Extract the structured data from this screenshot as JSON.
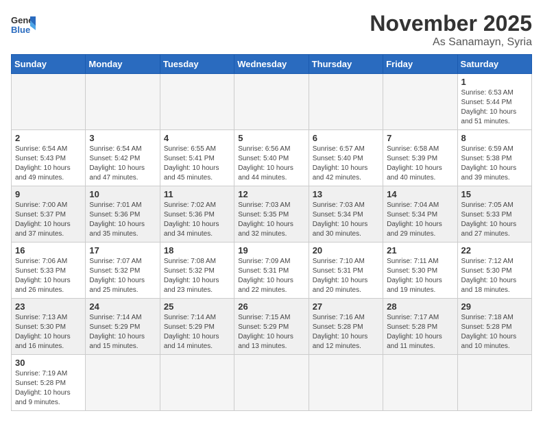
{
  "header": {
    "logo_general": "General",
    "logo_blue": "Blue",
    "month_title": "November 2025",
    "location": "As Sanamayn, Syria"
  },
  "weekdays": [
    "Sunday",
    "Monday",
    "Tuesday",
    "Wednesday",
    "Thursday",
    "Friday",
    "Saturday"
  ],
  "days": {
    "1": {
      "sunrise": "6:53 AM",
      "sunset": "5:44 PM",
      "daylight": "10 hours and 51 minutes."
    },
    "2": {
      "sunrise": "6:54 AM",
      "sunset": "5:43 PM",
      "daylight": "10 hours and 49 minutes."
    },
    "3": {
      "sunrise": "6:54 AM",
      "sunset": "5:42 PM",
      "daylight": "10 hours and 47 minutes."
    },
    "4": {
      "sunrise": "6:55 AM",
      "sunset": "5:41 PM",
      "daylight": "10 hours and 45 minutes."
    },
    "5": {
      "sunrise": "6:56 AM",
      "sunset": "5:40 PM",
      "daylight": "10 hours and 44 minutes."
    },
    "6": {
      "sunrise": "6:57 AM",
      "sunset": "5:40 PM",
      "daylight": "10 hours and 42 minutes."
    },
    "7": {
      "sunrise": "6:58 AM",
      "sunset": "5:39 PM",
      "daylight": "10 hours and 40 minutes."
    },
    "8": {
      "sunrise": "6:59 AM",
      "sunset": "5:38 PM",
      "daylight": "10 hours and 39 minutes."
    },
    "9": {
      "sunrise": "7:00 AM",
      "sunset": "5:37 PM",
      "daylight": "10 hours and 37 minutes."
    },
    "10": {
      "sunrise": "7:01 AM",
      "sunset": "5:36 PM",
      "daylight": "10 hours and 35 minutes."
    },
    "11": {
      "sunrise": "7:02 AM",
      "sunset": "5:36 PM",
      "daylight": "10 hours and 34 minutes."
    },
    "12": {
      "sunrise": "7:03 AM",
      "sunset": "5:35 PM",
      "daylight": "10 hours and 32 minutes."
    },
    "13": {
      "sunrise": "7:03 AM",
      "sunset": "5:34 PM",
      "daylight": "10 hours and 30 minutes."
    },
    "14": {
      "sunrise": "7:04 AM",
      "sunset": "5:34 PM",
      "daylight": "10 hours and 29 minutes."
    },
    "15": {
      "sunrise": "7:05 AM",
      "sunset": "5:33 PM",
      "daylight": "10 hours and 27 minutes."
    },
    "16": {
      "sunrise": "7:06 AM",
      "sunset": "5:33 PM",
      "daylight": "10 hours and 26 minutes."
    },
    "17": {
      "sunrise": "7:07 AM",
      "sunset": "5:32 PM",
      "daylight": "10 hours and 25 minutes."
    },
    "18": {
      "sunrise": "7:08 AM",
      "sunset": "5:32 PM",
      "daylight": "10 hours and 23 minutes."
    },
    "19": {
      "sunrise": "7:09 AM",
      "sunset": "5:31 PM",
      "daylight": "10 hours and 22 minutes."
    },
    "20": {
      "sunrise": "7:10 AM",
      "sunset": "5:31 PM",
      "daylight": "10 hours and 20 minutes."
    },
    "21": {
      "sunrise": "7:11 AM",
      "sunset": "5:30 PM",
      "daylight": "10 hours and 19 minutes."
    },
    "22": {
      "sunrise": "7:12 AM",
      "sunset": "5:30 PM",
      "daylight": "10 hours and 18 minutes."
    },
    "23": {
      "sunrise": "7:13 AM",
      "sunset": "5:30 PM",
      "daylight": "10 hours and 16 minutes."
    },
    "24": {
      "sunrise": "7:14 AM",
      "sunset": "5:29 PM",
      "daylight": "10 hours and 15 minutes."
    },
    "25": {
      "sunrise": "7:14 AM",
      "sunset": "5:29 PM",
      "daylight": "10 hours and 14 minutes."
    },
    "26": {
      "sunrise": "7:15 AM",
      "sunset": "5:29 PM",
      "daylight": "10 hours and 13 minutes."
    },
    "27": {
      "sunrise": "7:16 AM",
      "sunset": "5:28 PM",
      "daylight": "10 hours and 12 minutes."
    },
    "28": {
      "sunrise": "7:17 AM",
      "sunset": "5:28 PM",
      "daylight": "10 hours and 11 minutes."
    },
    "29": {
      "sunrise": "7:18 AM",
      "sunset": "5:28 PM",
      "daylight": "10 hours and 10 minutes."
    },
    "30": {
      "sunrise": "7:19 AM",
      "sunset": "5:28 PM",
      "daylight": "10 hours and 9 minutes."
    }
  }
}
